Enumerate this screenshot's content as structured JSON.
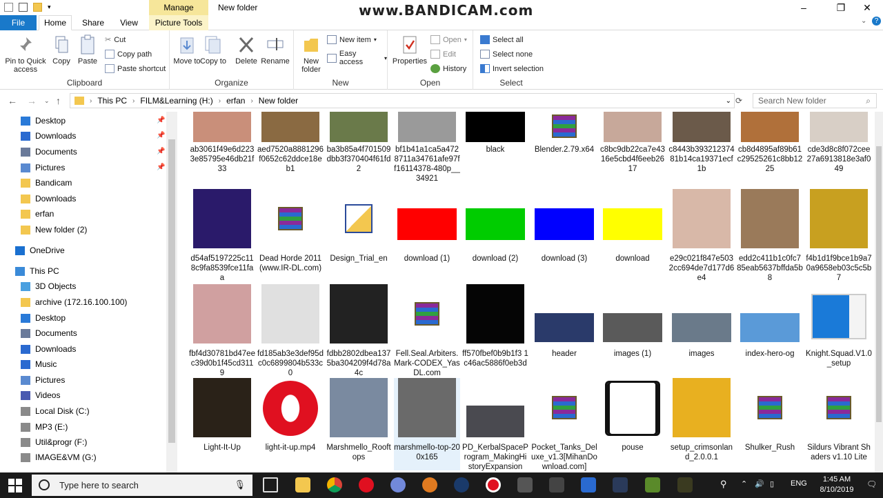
{
  "window": {
    "title": "New folder",
    "manage_tab": "Manage",
    "watermark": "www.BANDICAM.com"
  },
  "tabs": [
    "File",
    "Home",
    "Share",
    "View",
    "Picture Tools"
  ],
  "ribbon": {
    "clipboard": {
      "label": "Clipboard",
      "pin": "Pin to Quick access",
      "copy": "Copy",
      "paste": "Paste",
      "cut": "Cut",
      "copy_path": "Copy path",
      "paste_shortcut": "Paste shortcut"
    },
    "organize": {
      "label": "Organize",
      "move_to": "Move to",
      "copy_to": "Copy to",
      "delete": "Delete",
      "rename": "Rename"
    },
    "new": {
      "label": "New",
      "new_folder": "New folder",
      "new_item": "New item",
      "easy_access": "Easy access"
    },
    "open": {
      "label": "Open",
      "properties": "Properties",
      "open": "Open",
      "edit": "Edit",
      "history": "History"
    },
    "select": {
      "label": "Select",
      "select_all": "Select all",
      "select_none": "Select none",
      "invert": "Invert selection"
    }
  },
  "address": {
    "parts": [
      "This PC",
      "FILM&Learning (H:)",
      "erfan",
      "New folder"
    ],
    "search_placeholder": "Search New folder"
  },
  "nav": [
    {
      "label": "Desktop",
      "icon": "desktop-icon",
      "pinned": true
    },
    {
      "label": "Downloads",
      "icon": "download-icon",
      "pinned": true
    },
    {
      "label": "Documents",
      "icon": "documents-icon",
      "pinned": true
    },
    {
      "label": "Pictures",
      "icon": "pictures-icon",
      "pinned": true
    },
    {
      "label": "Bandicam",
      "icon": "folder-icon"
    },
    {
      "label": "Downloads",
      "icon": "folder-icon"
    },
    {
      "label": "erfan",
      "icon": "folder-icon"
    },
    {
      "label": "New folder (2)",
      "icon": "folder-icon"
    },
    {
      "label": "OneDrive",
      "icon": "onedrive-icon"
    },
    {
      "label": "This PC",
      "icon": "pc-icon"
    },
    {
      "label": "3D Objects",
      "icon": "3d-objects-icon"
    },
    {
      "label": "archive (172.16.100.100)",
      "icon": "folder-icon"
    },
    {
      "label": "Desktop",
      "icon": "desktop-icon"
    },
    {
      "label": "Documents",
      "icon": "documents-icon"
    },
    {
      "label": "Downloads",
      "icon": "download-icon"
    },
    {
      "label": "Music",
      "icon": "music-icon"
    },
    {
      "label": "Pictures",
      "icon": "pictures-icon"
    },
    {
      "label": "Videos",
      "icon": "videos-icon"
    },
    {
      "label": "Local Disk (C:)",
      "icon": "drive-icon"
    },
    {
      "label": "MP3 (E:)",
      "icon": "drive-icon"
    },
    {
      "label": "Util&progr (F:)",
      "icon": "drive-icon"
    },
    {
      "label": "IMAGE&VM (G:)",
      "icon": "drive-icon"
    }
  ],
  "files": [
    {
      "name": "ab3061f49e6d2233e85795e46db21f33",
      "thumb": "#c98f7a"
    },
    {
      "name": "aed7520a8881296f0652c62ddce18eb1",
      "thumb": "#8a6a42"
    },
    {
      "name": "ba3b85a4f701509dbb3f370404f61fd2",
      "thumb": "#6a7a4a"
    },
    {
      "name": "bf1b41a1ca5a4728711a34761afe97ff16114378-480p__34921",
      "thumb": "#9a9a9a"
    },
    {
      "name": "black",
      "thumb": "#000000"
    },
    {
      "name": "Blender.2.79.x64",
      "thumb": "archive"
    },
    {
      "name": "c8bc9db22ca7e4316e5cbd4f6eeb2617",
      "thumb": "#c7a89a"
    },
    {
      "name": "c8443b393212374 81b14ca19371ecf1b",
      "thumb": "#6b5a4a"
    },
    {
      "name": "cb8d4895af89b61c29525261c8bb1225",
      "thumb": "#b0703a"
    },
    {
      "name": "cde3d8c8f072cee27a6913818e3af049",
      "thumb": "#d8cfc6"
    },
    {
      "name": "d54af5197225c118c9fa8539fce11faa",
      "thumb": "#2a1a6a"
    },
    {
      "name": "Dead Horde 2011(www.IR-DL.com)",
      "thumb": "archive"
    },
    {
      "name": "Design_Trial_en",
      "thumb": "installer"
    },
    {
      "name": "download (1)",
      "thumb": "#ff0000"
    },
    {
      "name": "download (2)",
      "thumb": "#00cc00"
    },
    {
      "name": "download (3)",
      "thumb": "#0000ff"
    },
    {
      "name": "download",
      "thumb": "#ffff00"
    },
    {
      "name": "e29c021f847e5032cc694de7d177d6e4",
      "thumb": "#d8b8a8"
    },
    {
      "name": "edd2c411b1c0fc785eab5637bffda5b8",
      "thumb": "#9a7a5a"
    },
    {
      "name": "f4b1d1f9bce1b9a70a9658eb03c5c5b7",
      "thumb": "#c8a020"
    },
    {
      "name": "fbf4d30781bd47eec39d0b1f45cd3119",
      "thumb": "#d0a0a0"
    },
    {
      "name": "fd185ab3e3def95dc0c6899804b533c0",
      "thumb": "#e0e0e0"
    },
    {
      "name": "fdbb2802dbea1375ba304209f4d78a4c",
      "thumb": "#222222"
    },
    {
      "name": "Fell.Seal.Arbiters.Mark-CODEX_YasDL.com",
      "thumb": "archive"
    },
    {
      "name": "ff570fbef0b9b1f3 1c46ac5886f0eb3d",
      "thumb": "#050505"
    },
    {
      "name": "header",
      "thumb": "#2a3a6a"
    },
    {
      "name": "images (1)",
      "thumb": "#5a5a5a"
    },
    {
      "name": "images",
      "thumb": "#6a7a8a"
    },
    {
      "name": "index-hero-og",
      "thumb": "#5a9ad8"
    },
    {
      "name": "Knight.Squad.V1.0_setup",
      "thumb": "window"
    },
    {
      "name": "Light-It-Up",
      "thumb": "#2a2218"
    },
    {
      "name": "light-it-up.mp4",
      "thumb": "opera"
    },
    {
      "name": "Marshmello_Rooftops",
      "thumb": "#7a8aa0"
    },
    {
      "name": "marshmello-top-200x165",
      "thumb": "#6a6a6a"
    },
    {
      "name": "PD_KerbalSpaceProgram_MakingHistoryExpansion",
      "thumb": "#4a4a50"
    },
    {
      "name": "Pocket_Tanks_Deluxe_v1.3[MihanDownload.com]",
      "thumb": "archive"
    },
    {
      "name": "pouse",
      "thumb": "pause"
    },
    {
      "name": "setup_crimsonland_2.0.0.1",
      "thumb": "#e8b020"
    },
    {
      "name": "Shulker_Rush",
      "thumb": "archive"
    },
    {
      "name": "Sildurs Vibrant Shaders v1.10 Lite",
      "thumb": "archive"
    }
  ],
  "taskbar": {
    "search_placeholder": "Type here to search",
    "lang": "ENG",
    "time": "1:45 AM",
    "date": "8/10/2019"
  }
}
